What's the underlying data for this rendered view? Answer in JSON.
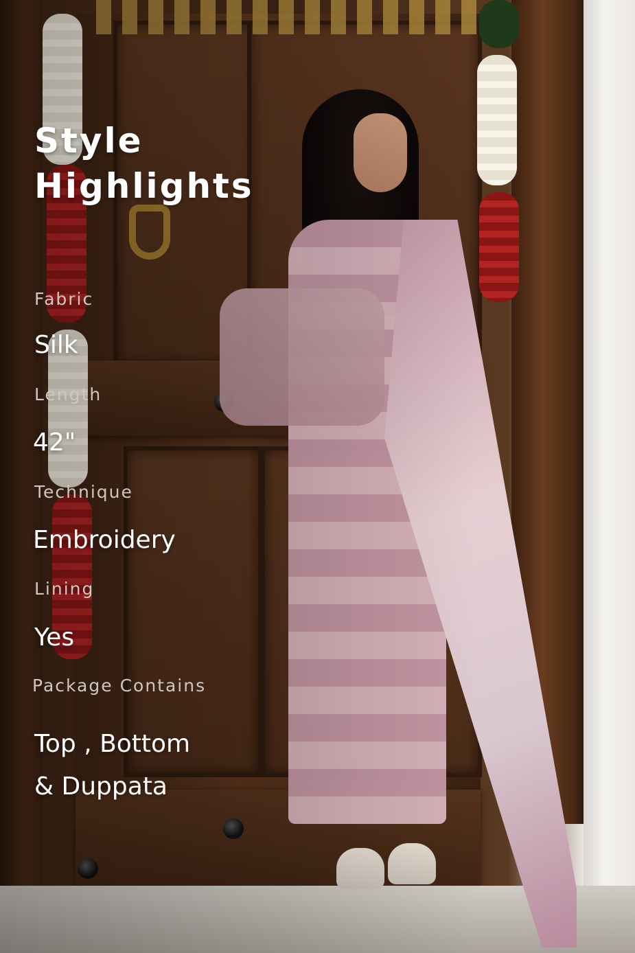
{
  "heading": {
    "title": "Style\nHighlights"
  },
  "specs": [
    {
      "label": "Fabric",
      "value": "Silk"
    },
    {
      "label": "Length",
      "value": "42\""
    },
    {
      "label": "Technique",
      "value": "Embroidery"
    },
    {
      "label": "Lining",
      "value": "Yes"
    },
    {
      "label": "Package Contains",
      "value": "Top , Bottom\n& Duppata"
    }
  ],
  "colors": {
    "title": "#ffffff",
    "label": "#cfc6c0",
    "value": "#ffffff",
    "garment": "#d7b2bd",
    "door": "#4a2b18"
  }
}
